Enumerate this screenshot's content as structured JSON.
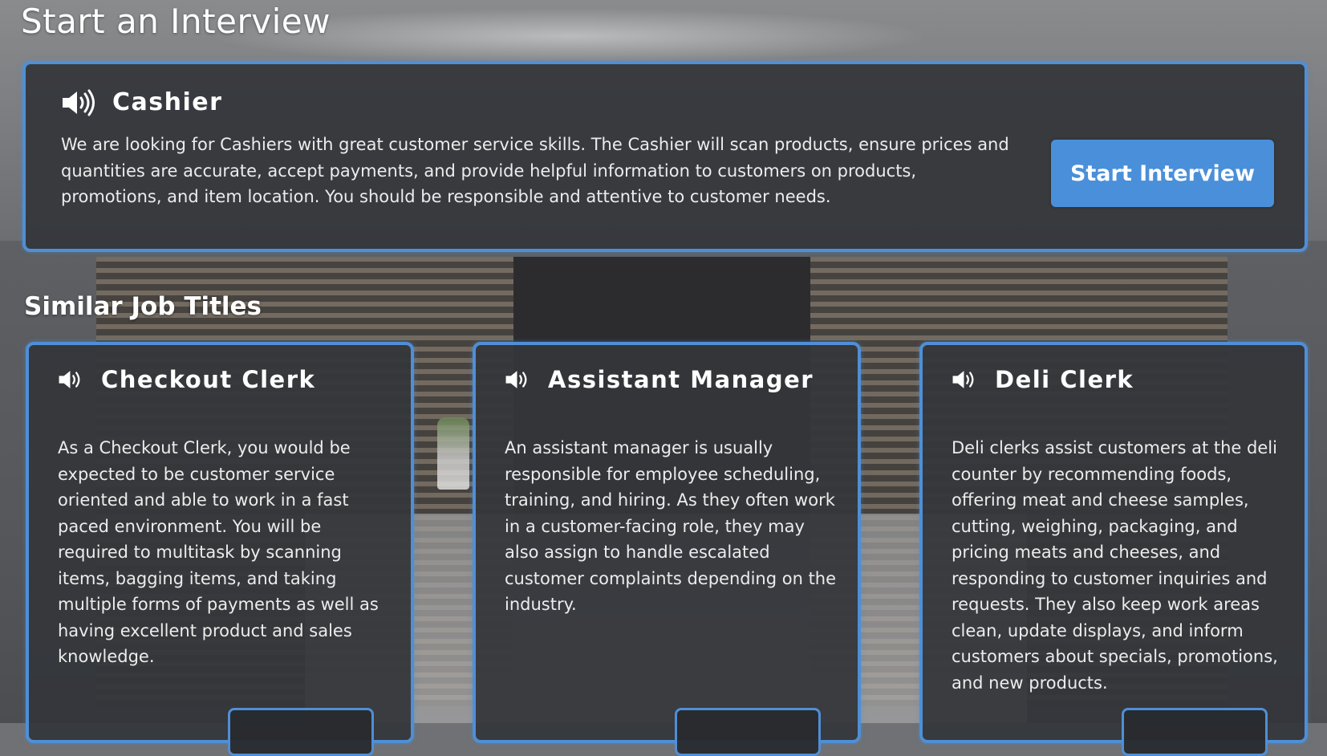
{
  "page": {
    "title": "Start an Interview"
  },
  "featured_job": {
    "title": "Cashier",
    "description": "We are looking for Cashiers with great customer service skills. The Cashier will scan products, ensure prices and quantities are accurate, accept payments, and provide helpful information to customers on products, promotions, and item location. You should be responsible and attentive to customer needs.",
    "button_label": "Start Interview"
  },
  "similar": {
    "heading": "Similar Job Titles",
    "jobs": [
      {
        "title": "Checkout Clerk",
        "description": "As a Checkout Clerk, you would be expected to be customer service oriented and able to work in a fast paced environment. You will be required to multitask by scanning items, bagging items, and taking multiple forms of payments as well as having excellent product and sales knowledge."
      },
      {
        "title": "Assistant Manager",
        "description": "An assistant manager is usually responsible for employee scheduling, training, and hiring. As they often work in a customer-facing role, they may also assign to handle escalated customer complaints depending on the industry."
      },
      {
        "title": "Deli Clerk",
        "description": "Deli clerks assist customers at the deli counter by recommending foods, offering meat and cheese samples, cutting, weighing, packaging, and pricing meats and cheeses, and responding to customer inquiries and requests. They also keep work areas clean, update displays, and inform customers about specials, promotions, and new products."
      }
    ]
  },
  "icons": {
    "audio": "speaker-icon"
  },
  "colors": {
    "accent": "#4a8fd9",
    "card_bg": "#34363a",
    "text": "#ffffff"
  }
}
